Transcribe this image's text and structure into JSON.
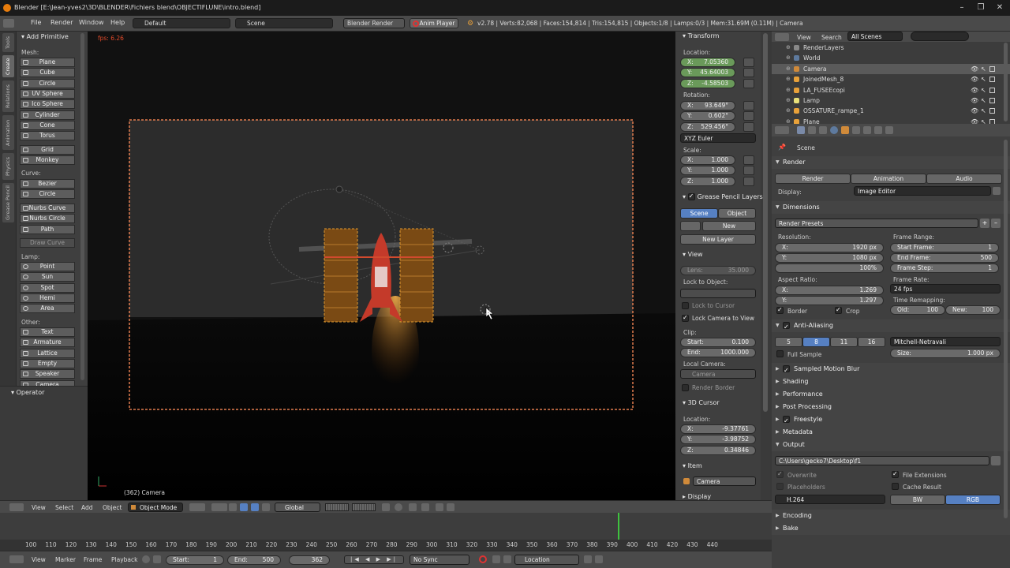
{
  "title": {
    "text": "Blender [E:\\Jean-yves2\\3D\\BLENDER\\Fichiers blend\\OBJECTIFLUNE\\intro.blend]"
  },
  "menu": {
    "file": "File",
    "render": "Render",
    "window": "Window",
    "help": "Help"
  },
  "layout": {
    "value": "Default"
  },
  "scene": {
    "value": "Scene"
  },
  "engine": {
    "value": "Blender Render"
  },
  "anim_player": "Anim Player",
  "stats": "v2.78 | Verts:82,068 | Faces:154,814 | Tris:154,815 | Objects:1/8 | Lamps:0/3 | Mem:31.69M (0.11M) | Camera",
  "toolshelf": {
    "tabs": [
      "Tools",
      "Create",
      "Relations",
      "Animation",
      "Physics",
      "Grease Pencil"
    ],
    "header": "Add Primitive",
    "mesh_label": "Mesh:",
    "mesh": [
      "Plane",
      "Cube",
      "Circle",
      "UV Sphere",
      "Ico Sphere",
      "Cylinder",
      "Cone",
      "Torus"
    ],
    "grid": "Grid",
    "monkey": "Monkey",
    "curve_label": "Curve:",
    "curve": [
      "Bezier",
      "Circle"
    ],
    "nurbs": [
      "Nurbs Curve",
      "Nurbs Circle",
      "Path"
    ],
    "draw_curve": "Draw Curve",
    "lamp_label": "Lamp:",
    "lamp": [
      "Point",
      "Sun",
      "Spot",
      "Hemi",
      "Area"
    ],
    "other_label": "Other:",
    "other": [
      "Text",
      "Armature",
      "Lattice",
      "Empty",
      "Speaker",
      "Camera"
    ],
    "operator": "Operator"
  },
  "viewport": {
    "fps": "fps: 6.26",
    "object_label": "(362) Camera"
  },
  "npanel": {
    "transform": "Transform",
    "location_label": "Location:",
    "location": [
      {
        "k": "X:",
        "v": "7.05360"
      },
      {
        "k": "Y:",
        "v": "45.64003"
      },
      {
        "k": "Z:",
        "v": "-4.58503"
      }
    ],
    "rotation_label": "Rotation:",
    "rotation": [
      {
        "k": "X:",
        "v": "93.649°"
      },
      {
        "k": "Y:",
        "v": "0.602°"
      },
      {
        "k": "Z:",
        "v": "529.456°"
      }
    ],
    "euler": "XYZ Euler",
    "scale_label": "Scale:",
    "scale": [
      {
        "k": "X:",
        "v": "1.000"
      },
      {
        "k": "Y:",
        "v": "1.000"
      },
      {
        "k": "Z:",
        "v": "1.000"
      }
    ],
    "grease": "Grease Pencil Layers",
    "scene_btn": "Scene",
    "object_btn": "Object",
    "new_btn": "New",
    "new_layer": "New Layer",
    "view": "View",
    "lens": {
      "k": "Lens:",
      "v": "35.000"
    },
    "lock_obj": "Lock to Object:",
    "lock_cursor": "Lock to Cursor",
    "lock_camera": "Lock Camera to View",
    "clip": "Clip:",
    "clip_start": {
      "k": "Start:",
      "v": "0.100"
    },
    "clip_end": {
      "k": "End:",
      "v": "1000.000"
    },
    "local_camera": "Local Camera:",
    "camera_field": "Camera",
    "render_border": "Render Border",
    "cursor": "3D Cursor",
    "cursor_loc": "Location:",
    "cursor_vals": [
      {
        "k": "X:",
        "v": "-9.37761"
      },
      {
        "k": "Y:",
        "v": "-3.98752"
      },
      {
        "k": "Z:",
        "v": "0.34846"
      }
    ],
    "item": "Item",
    "item_name": "Camera",
    "display": "Display"
  },
  "outliner": {
    "view": "View",
    "search": "Search",
    "filter": "All Scenes",
    "rows": [
      "RenderLayers",
      "World",
      "Camera",
      "JoinedMesh_8",
      "LA_FUSEEcopi",
      "Lamp",
      "OSSATURE_rampe_1",
      "Plane"
    ]
  },
  "props": {
    "scene_path": "Scene",
    "render": "Render",
    "render_btn": "Render",
    "animation_btn": "Animation",
    "audio_btn": "Audio",
    "display_label": "Display:",
    "display_val": "Image Editor",
    "dimensions": "Dimensions",
    "presets": "Render Presets",
    "resolution_label": "Resolution:",
    "res_x": {
      "k": "X:",
      "v": "1920 px"
    },
    "res_y": {
      "k": "Y:",
      "v": "1080 px"
    },
    "res_pct": "100%",
    "frame_range_label": "Frame Range:",
    "start_frame": {
      "k": "Start Frame:",
      "v": "1"
    },
    "end_frame": {
      "k": "End Frame:",
      "v": "500"
    },
    "frame_step": {
      "k": "Frame Step:",
      "v": "1"
    },
    "aspect_label": "Aspect Ratio:",
    "asp_x": {
      "k": "X:",
      "v": "1.269"
    },
    "asp_y": {
      "k": "Y:",
      "v": "1.297"
    },
    "frame_rate_label": "Frame Rate:",
    "fps": "24 fps",
    "time_remap": "Time Remapping:",
    "old": {
      "k": "Old:",
      "v": "100"
    },
    "new": {
      "k": "New:",
      "v": "100"
    },
    "border": "Border",
    "crop": "Crop",
    "aa": "Anti-Aliasing",
    "aa_vals": [
      "5",
      "8",
      "11",
      "16"
    ],
    "filter": "Mitchell-Netravali",
    "full_sample": "Full Sample",
    "size": {
      "k": "Size:",
      "v": "1.000 px"
    },
    "panels": [
      "Sampled Motion Blur",
      "Shading",
      "Performance",
      "Post Processing",
      "Freestyle",
      "Metadata"
    ],
    "output": "Output",
    "path": "C:\\Users\\gecko7\\Desktop\\f1",
    "overwrite": "Overwrite",
    "file_ext": "File Extensions",
    "placeholders": "Placeholders",
    "cache": "Cache Result",
    "codec": "H.264",
    "bw": "BW",
    "rgb": "RGB",
    "encoding": "Encoding",
    "bake": "Bake"
  },
  "vheader": {
    "view": "View",
    "select": "Select",
    "add": "Add",
    "object": "Object",
    "mode": "Object Mode",
    "orient": "Global"
  },
  "timeline": {
    "ticks": [
      "100",
      "110",
      "120",
      "130",
      "140",
      "150",
      "160",
      "170",
      "180",
      "190",
      "200",
      "210",
      "220",
      "230",
      "240",
      "250",
      "260",
      "270",
      "280",
      "290",
      "300",
      "310",
      "320",
      "330",
      "340",
      "350",
      "360",
      "370",
      "380",
      "390",
      "400",
      "410",
      "420",
      "430",
      "440"
    ],
    "view": "View",
    "marker": "Marker",
    "frame": "Frame",
    "playback": "Playback",
    "start": {
      "k": "Start:",
      "v": "1"
    },
    "end": {
      "k": "End:",
      "v": "500"
    },
    "current": "362",
    "sync": "No Sync",
    "keying": "Location"
  }
}
